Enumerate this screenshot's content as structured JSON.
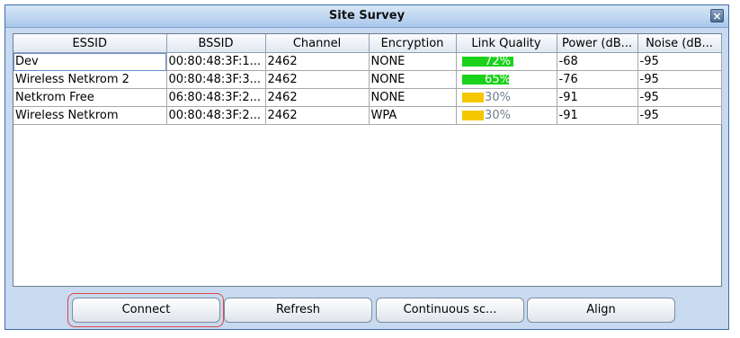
{
  "window": {
    "title": "Site Survey",
    "close_icon": "×"
  },
  "table": {
    "columns": [
      "ESSID",
      "BSSID",
      "Channel",
      "Encryption",
      "Link Quality",
      "Power (dB...",
      "Noise (dB..."
    ],
    "rows": [
      {
        "essid": "Dev",
        "bssid": "00:80:48:3F:1...",
        "channel": "2462",
        "encryption": "NONE",
        "link_quality": "72%",
        "link_quality_value": 72,
        "link_color": "#1ad21a",
        "power": "-68",
        "noise": "-95"
      },
      {
        "essid": "Wireless Netkrom 2",
        "bssid": "00:80:48:3F:3...",
        "channel": "2462",
        "encryption": "NONE",
        "link_quality": "65%",
        "link_quality_value": 65,
        "link_color": "#1ad21a",
        "power": "-76",
        "noise": "-95"
      },
      {
        "essid": "Netkrom Free",
        "bssid": "06:80:48:3F:2...",
        "channel": "2462",
        "encryption": "NONE",
        "link_quality": "30%",
        "link_quality_value": 30,
        "link_color": "#f4c700",
        "power": "-91",
        "noise": "-95"
      },
      {
        "essid": "Wireless Netkrom",
        "bssid": "00:80:48:3F:2...",
        "channel": "2462",
        "encryption": "WPA",
        "link_quality": "30%",
        "link_quality_value": 30,
        "link_color": "#f4c700",
        "power": "-91",
        "noise": "-95"
      }
    ]
  },
  "buttons": {
    "connect": "Connect",
    "refresh": "Refresh",
    "continuous": "Continuous sc...",
    "align": "Align"
  },
  "colors": {
    "highlight": "#e04545",
    "title_bg": "#a9c7ea"
  }
}
